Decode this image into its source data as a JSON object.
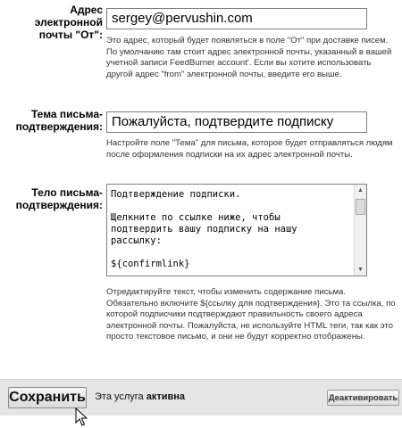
{
  "from_email": {
    "label": "Адрес электронной почты \"От\":",
    "value": "sergey@pervushin.com",
    "help": "Это адрес, который будет появляться в поле \"От\" при доставке писем. По умолчанию там стоит адрес электронной почты, указанный в вашей учетной записи FeedBurner account'. Если вы хотите использовать другой адрес \"from\" электронной почты, введите его выше."
  },
  "subject": {
    "label": "Тема письма-подтверждения:",
    "value": "Пожалуйста, подтвердите подписку",
    "help": "Настройте поле \"Тема\" для письма, которое будет отправляться людям после оформления подписки на их адрес электронной почты."
  },
  "body": {
    "label": "Тело письма-подтверждения:",
    "value": "Подтверждение подписки.\n\nЩелкните по ссылке ниже, чтобы\nподтвердить вашу подписку на нашу\nрассылку:\n\n${confirmlink}",
    "help": "Отредактируйте текст, чтобы изменить содержание письма. Обязательно включите ${ссылку для подтверждения}. Это та ссылка, по которой подписчики подтверждают правильность своего адреса электронной почты. Пожалуйста, не используйте HTML теги, так как это просто текстовое письмо, и они не будут корректно отображены."
  },
  "footer": {
    "save_label": "Сохранить",
    "status_prefix": "Эта услуга",
    "status_value": "активна",
    "deactivate_label": "Деактивировать"
  },
  "icons": {
    "scroll_up": "scroll-up-arrow-icon",
    "scroll_down": "scroll-down-arrow-icon",
    "cursor": "mouse-pointer-icon"
  }
}
